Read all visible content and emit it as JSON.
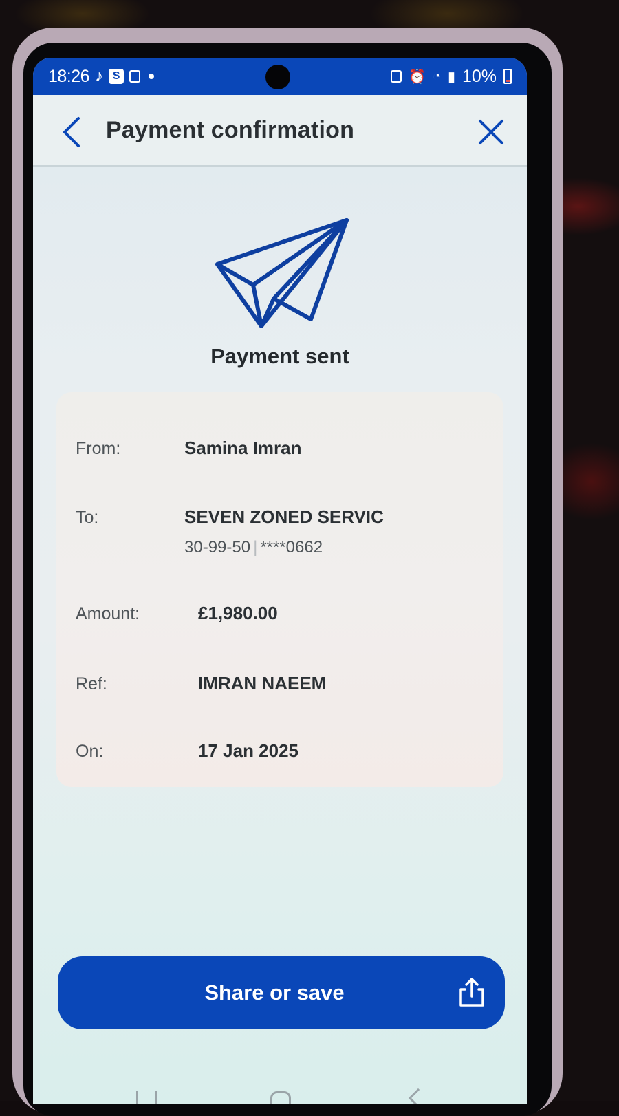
{
  "status_bar": {
    "time": "18:26",
    "app_badge": "S",
    "battery": "10%"
  },
  "header": {
    "title": "Payment confirmation"
  },
  "confirmation": {
    "status_text": "Payment sent"
  },
  "details": {
    "from_label": "From:",
    "from_value": "Samina Imran",
    "to_label": "To:",
    "to_value": "SEVEN ZONED SERVIC",
    "to_sort_code": "30-99-50",
    "to_account": "****0662",
    "amount_label": "Amount:",
    "amount_value": "£1,980.00",
    "ref_label": "Ref:",
    "ref_value": "IMRAN NAEEM",
    "on_label": "On:",
    "on_value": "17 Jan 2025"
  },
  "actions": {
    "share_label": "Share or save"
  },
  "colors": {
    "brand_blue": "#0a47b8",
    "text_dark": "#2b3034",
    "text_muted": "#4e5458"
  },
  "icons": [
    "back-arrow-icon",
    "close-icon",
    "paper-plane-icon",
    "share-icon"
  ]
}
